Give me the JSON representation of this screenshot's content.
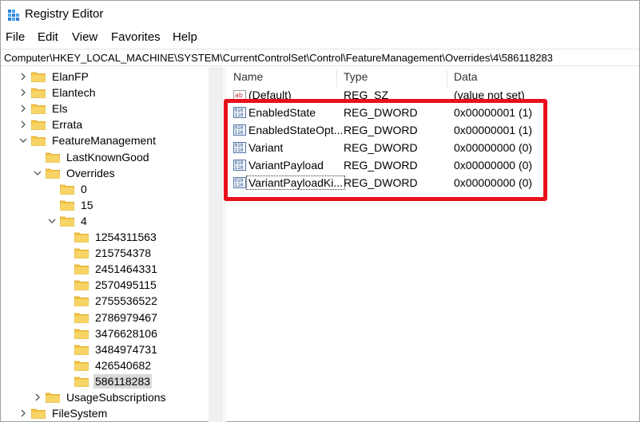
{
  "window": {
    "title": "Registry Editor"
  },
  "menu": [
    "File",
    "Edit",
    "View",
    "Favorites",
    "Help"
  ],
  "address": "Computer\\HKEY_LOCAL_MACHINE\\SYSTEM\\CurrentControlSet\\Control\\FeatureManagement\\Overrides\\4\\586118283",
  "tree": [
    {
      "label": "ElanFP",
      "chevron": "right"
    },
    {
      "label": "Elantech",
      "chevron": "right"
    },
    {
      "label": "Els",
      "chevron": "right"
    },
    {
      "label": "Errata",
      "chevron": "right"
    },
    {
      "label": "FeatureManagement",
      "chevron": "down"
    },
    {
      "label": "LastKnownGood",
      "chevron": "none"
    },
    {
      "label": "Overrides",
      "chevron": "down"
    },
    {
      "label": "0",
      "chevron": "none"
    },
    {
      "label": "15",
      "chevron": "none"
    },
    {
      "label": "4",
      "chevron": "down"
    },
    {
      "label": "1254311563",
      "chevron": "none"
    },
    {
      "label": "215754378",
      "chevron": "none"
    },
    {
      "label": "2451464331",
      "chevron": "none"
    },
    {
      "label": "2570495115",
      "chevron": "none"
    },
    {
      "label": "2755536522",
      "chevron": "none"
    },
    {
      "label": "2786979467",
      "chevron": "none"
    },
    {
      "label": "3476628106",
      "chevron": "none"
    },
    {
      "label": "3484974731",
      "chevron": "none"
    },
    {
      "label": "426540682",
      "chevron": "none"
    },
    {
      "label": "586118283",
      "chevron": "none",
      "selected": true
    },
    {
      "label": "UsageSubscriptions",
      "chevron": "right"
    },
    {
      "label": "FileSystem",
      "chevron": "right"
    }
  ],
  "columns": {
    "name": "Name",
    "type": "Type",
    "data": "Data"
  },
  "values": [
    {
      "name": "(Default)",
      "type": "REG_SZ",
      "data": "(value not set)",
      "icon": "string-value-icon"
    },
    {
      "name": "EnabledState",
      "type": "REG_DWORD",
      "data": "0x00000001 (1)",
      "icon": "dword-value-icon"
    },
    {
      "name": "EnabledStateOpt...",
      "type": "REG_DWORD",
      "data": "0x00000001 (1)",
      "icon": "dword-value-icon"
    },
    {
      "name": "Variant",
      "type": "REG_DWORD",
      "data": "0x00000000 (0)",
      "icon": "dword-value-icon"
    },
    {
      "name": "VariantPayload",
      "type": "REG_DWORD",
      "data": "0x00000000 (0)",
      "icon": "dword-value-icon"
    },
    {
      "name": "VariantPayloadKi...",
      "type": "REG_DWORD",
      "data": "0x00000000 (0)",
      "icon": "dword-value-icon",
      "focused": true
    }
  ],
  "colors": {
    "highlight": "#e8101c",
    "folder": "#f4c542",
    "selection": "#d9d9d9"
  }
}
